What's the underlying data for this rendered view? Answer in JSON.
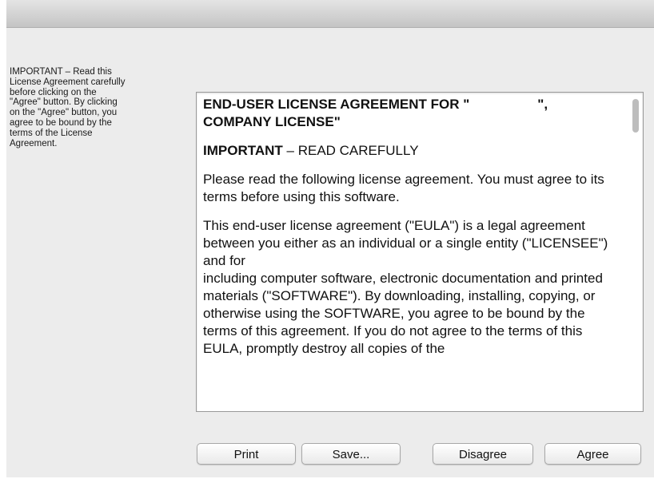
{
  "instructions": "IMPORTANT – Read this\nLicense Agreement carefully\nbefore clicking on the\n\"Agree\" button. By clicking\non the \"Agree\" button, you\nagree to be bound by the\nterms of the License\nAgreement.",
  "eula": {
    "title": "END-USER LICENSE AGREEMENT FOR \"                  \",\nCOMPANY LICENSE\"",
    "heading_bold": "IMPORTANT",
    "heading_rest": " – READ CAREFULLY",
    "paragraph1": "Please read the following license agreement. You must agree to its terms before using this software.",
    "paragraph2": "This end-user license agreement (\"EULA\") is a legal agreement between you either as an individual or a single entity (\"LICENSEE\") and                          for\n                    including computer software, electronic documentation and printed materials (\"SOFTWARE\"). By downloading, installing, copying, or otherwise using the SOFTWARE, you agree to be bound by the terms of this agreement. If you do not agree to the terms of this EULA, promptly destroy all copies of the"
  },
  "buttons": {
    "print": "Print",
    "save": "Save...",
    "disagree": "Disagree",
    "agree": "Agree"
  }
}
